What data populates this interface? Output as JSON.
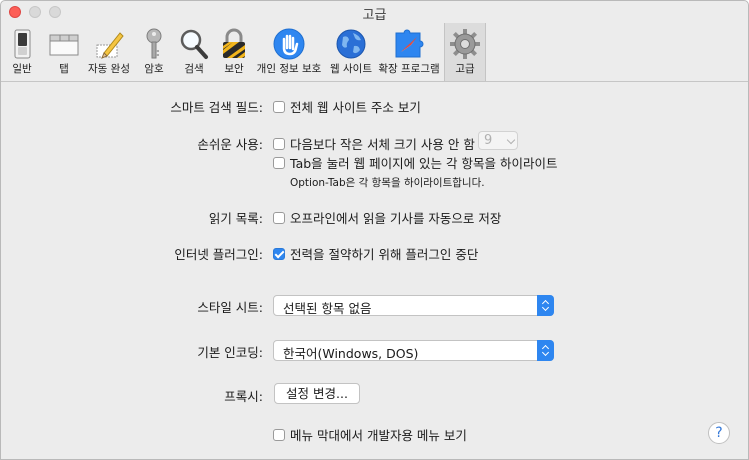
{
  "window": {
    "title": "고급"
  },
  "toolbar": {
    "items": [
      {
        "label": "일반",
        "icon": "switch-icon"
      },
      {
        "label": "탭",
        "icon": "tabs-icon"
      },
      {
        "label": "자동 완성",
        "icon": "pencil-icon"
      },
      {
        "label": "암호",
        "icon": "key-icon"
      },
      {
        "label": "검색",
        "icon": "magnifier-icon"
      },
      {
        "label": "보안",
        "icon": "padlock-icon"
      },
      {
        "label": "개인 정보 보호",
        "icon": "hand-icon"
      },
      {
        "label": "웹 사이트",
        "icon": "globe-icon"
      },
      {
        "label": "확장 프로그램",
        "icon": "puzzle-compass-icon"
      },
      {
        "label": "고급",
        "icon": "gear-icon",
        "active": true
      }
    ]
  },
  "settings": {
    "smart_search": {
      "label": "스마트 검색 필드:",
      "option": "전체 웹 사이트 주소 보기",
      "checked": false
    },
    "accessibility": {
      "label": "손쉬운 사용:",
      "min_font": {
        "option": "다음보다 작은 서체 크기 사용 안 함",
        "checked": false,
        "value": "9"
      },
      "tab_highlight": {
        "option": "Tab을 눌러 웹 페이지에 있는 각 항목을 하이라이트",
        "checked": false
      },
      "note": "Option-Tab은 각 항목을 하이라이트합니다."
    },
    "reading_list": {
      "label": "읽기 목록:",
      "option": "오프라인에서 읽을 기사를 자동으로 저장",
      "checked": false
    },
    "plugins": {
      "label": "인터넷 플러그인:",
      "option": "전력을 절약하기 위해 플러그인 중단",
      "checked": true
    },
    "stylesheet": {
      "label": "스타일 시트:",
      "value": "선택된 항목 없음"
    },
    "encoding": {
      "label": "기본 인코딩:",
      "value": "한국어(Windows, DOS)"
    },
    "proxy": {
      "label": "프록시:",
      "button": "설정 변경..."
    },
    "develop_menu": {
      "option": "메뉴 막대에서 개발자용 메뉴 보기",
      "checked": false
    }
  },
  "help": {
    "glyph": "?"
  },
  "colors": {
    "accent": "#2e86f0",
    "close": "#fc5f57",
    "background": "#ececec"
  }
}
